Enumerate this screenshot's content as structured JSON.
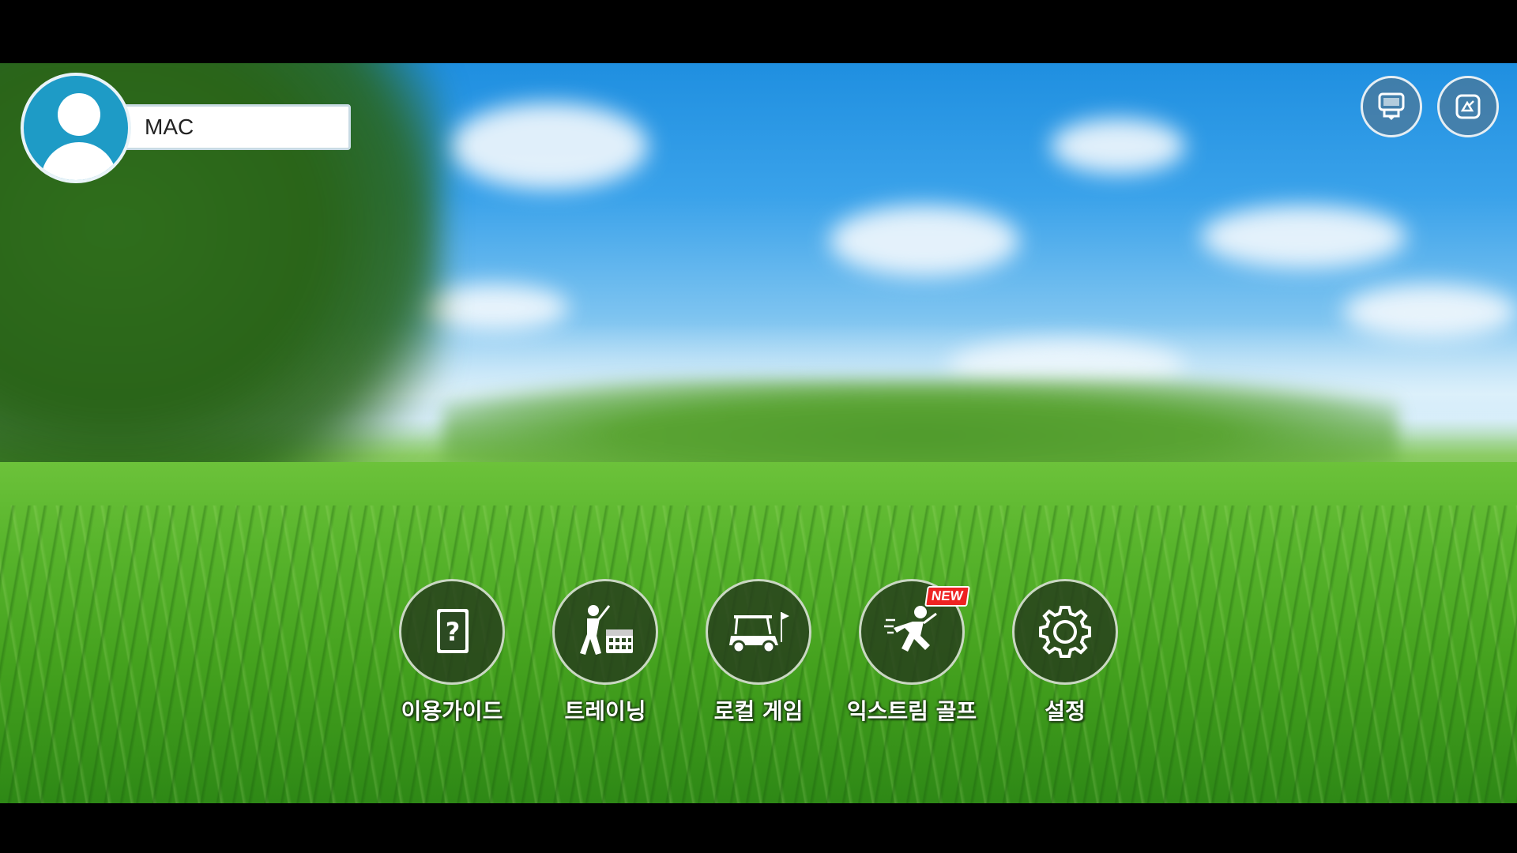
{
  "profile": {
    "username": "MAC"
  },
  "top_buttons": [
    {
      "icon": "kiosk-icon"
    },
    {
      "icon": "screen-mode-icon"
    }
  ],
  "menu": [
    {
      "label": "이용가이드",
      "icon": "guide-book-icon"
    },
    {
      "label": "트레이닝",
      "icon": "training-icon"
    },
    {
      "label": "로컬 게임",
      "icon": "golf-cart-icon"
    },
    {
      "label": "익스트림 골프",
      "icon": "extreme-golfer-icon",
      "badge": "NEW"
    },
    {
      "label": "설정",
      "icon": "gear-icon"
    }
  ]
}
